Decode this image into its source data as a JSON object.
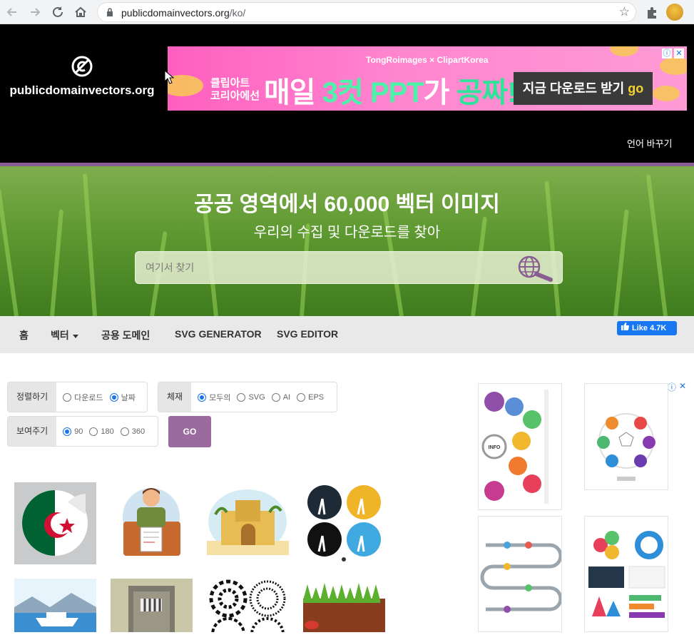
{
  "browser": {
    "back_icon": "arrow-left-icon",
    "forward_icon": "arrow-right-icon",
    "reload_icon": "reload-icon",
    "home_icon": "home-icon",
    "url_domain": "publicdomainvectors.org",
    "url_path": "/ko/",
    "bookmark_icon": "star-icon",
    "extensions_icon": "puzzle-icon"
  },
  "header": {
    "logo_text": "publicdomainvectors.org",
    "lang_link": "언어 바꾸기"
  },
  "ad_banner": {
    "brand_left": "TongRoimages",
    "separator": "×",
    "brand_right": "ClipartKorea",
    "sub_line1": "클립아트",
    "sub_line2": "코리아에선",
    "main_prefix": "매일 ",
    "main_highlight": "3컷 PPT",
    "main_mid": "가 ",
    "main_emph": "공짜!",
    "cta_text": "지금 다운로드 받기 ",
    "cta_go": "go",
    "adchoices": "ⓘ",
    "close": "✕"
  },
  "hero": {
    "title": "공공 영역에서 60,000 벡터 이미지",
    "subtitle": "우리의 수집 및 다운로드를 찾아",
    "search_placeholder": "여기서 찾기"
  },
  "nav": {
    "items": [
      "홈",
      "벡터",
      "공용 도메인",
      "SVG GENERATOR",
      "SVG EDITOR"
    ],
    "fb_like": "Like 4.7K"
  },
  "filters": {
    "sort": {
      "label": "정렬하기",
      "options": [
        "다운로드",
        "날짜"
      ],
      "selected": "날짜"
    },
    "format": {
      "label": "체재",
      "options": [
        "모두의",
        "SVG",
        "AI",
        "EPS"
      ],
      "selected": "모두의"
    },
    "show": {
      "label": "보여주기",
      "options": [
        "90",
        "180",
        "360"
      ],
      "selected": "90"
    },
    "go_label": "GO"
  },
  "thumbnails": [
    {
      "name": "algeria-flag-sticker"
    },
    {
      "name": "man-signing-document"
    },
    {
      "name": "sand-castle"
    },
    {
      "name": "palm-trees-circles"
    },
    {
      "name": "yacht-sea"
    },
    {
      "name": "prison-window"
    },
    {
      "name": "spiral-patterns"
    },
    {
      "name": "grass-soil"
    }
  ],
  "side_ad": {
    "adchoices": "ⓘ",
    "close": "✕",
    "info_label": "INFO"
  },
  "colors": {
    "accent_purple": "#9b6a9f",
    "header_bg": "#000000",
    "nav_bg": "#e9e9e9",
    "radio_blue": "#1a73e8",
    "fb_blue": "#1877f2"
  }
}
